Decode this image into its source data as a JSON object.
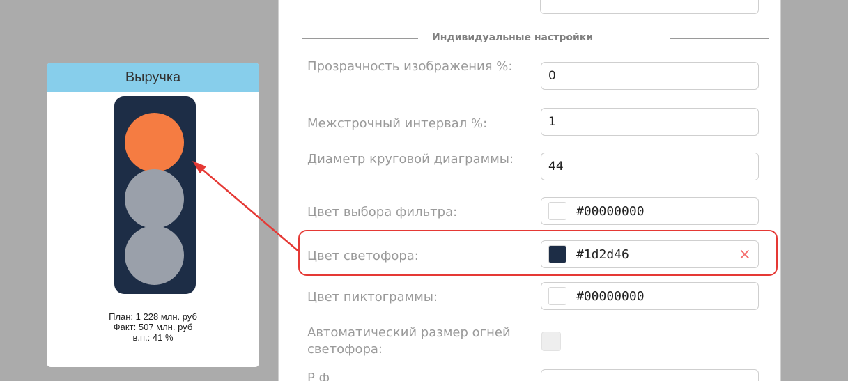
{
  "widget": {
    "title": "Выручка",
    "lamp_colors": {
      "top": "#f57c42",
      "middle": "#9aa0aa",
      "bottom": "#9aa0aa"
    },
    "housing_color": "#1d2d46",
    "stats": [
      "План: 1 228 млн. руб",
      "Факт: 507 млн. руб",
      "в.п.: 41 %"
    ]
  },
  "settings": {
    "section_title": "Индивидуальные настройки",
    "fields": [
      {
        "label": "Прозрачность изображения %:",
        "value": "0"
      },
      {
        "label": "Межстрочный интервал %:",
        "value": "1"
      },
      {
        "label": "Диаметр круговой диаграммы:",
        "value": "44"
      }
    ],
    "filter_color": {
      "label": "Цвет выбора фильтра:",
      "value": "#00000000",
      "swatch": "#ffffff"
    },
    "traffic_light_color": {
      "label": "Цвет светофора:",
      "value": "#1d2d46",
      "swatch": "#1d2d46",
      "clear_icon": "×"
    },
    "pictogram_color": {
      "label": "Цвет пиктограммы:",
      "value": "#00000000",
      "swatch": "#ffffff"
    },
    "auto_size": {
      "label": "Автоматический размер огней светофора:",
      "checked": false
    },
    "next_label_partial": "Р                    ф"
  },
  "colors": {
    "highlight": "#e53935",
    "accent_header": "#87ceeb"
  }
}
